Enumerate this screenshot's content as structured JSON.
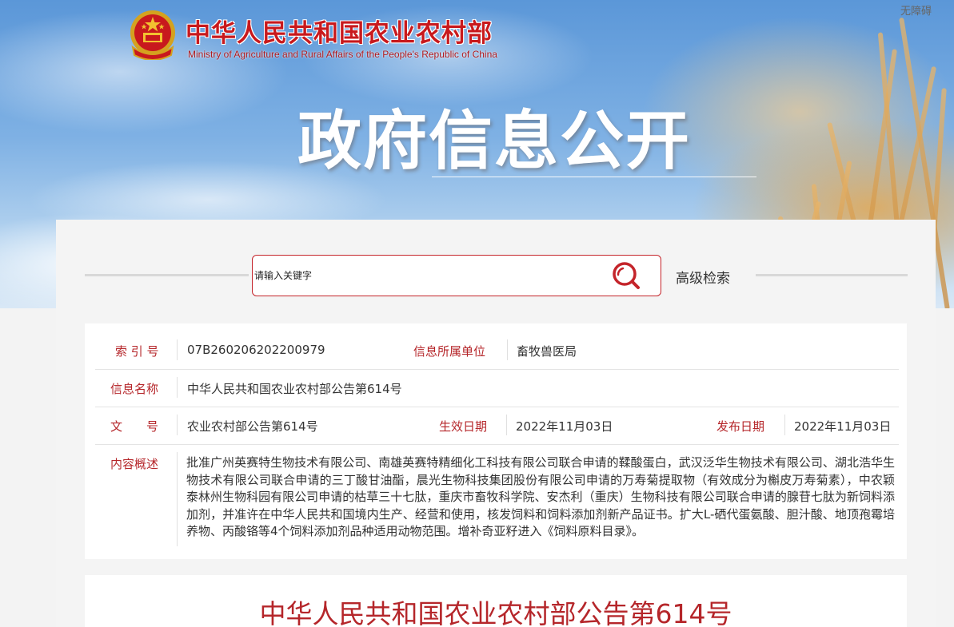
{
  "header": {
    "ministry_name_cn": "中华人民共和国农业农村部",
    "ministry_name_en": "Ministry of Agriculture and Rural Affairs of the People's Republic of China",
    "accessibility_link": "无障碍",
    "hero_title": "政府信息公开"
  },
  "search": {
    "placeholder": "请输入关键字",
    "advanced_label": "高级检索"
  },
  "info": {
    "index_label": "索 引 号",
    "index_value": "07B260206202200979",
    "unit_label": "信息所属单位",
    "unit_value": "畜牧兽医局",
    "name_label": "信息名称",
    "name_value": "中华人民共和国农业农村部公告第614号",
    "doc_no_label": "文　　号",
    "doc_no_value": "农业农村部公告第614号",
    "effective_label": "生效日期",
    "effective_value": "2022年11月03日",
    "publish_label": "发布日期",
    "publish_value": "2022年11月03日",
    "summary_label": "内容概述",
    "summary_value": "批准广州英赛特生物技术有限公司、南雄英赛特精细化工科技有限公司联合申请的鞣酸蛋白，武汉泛华生物技术有限公司、湖北浩华生物技术有限公司联合申请的三丁酸甘油酯，晨光生物科技集团股份有限公司申请的万寿菊提取物（有效成分为槲皮万寿菊素），中农颖泰林州生物科园有限公司申请的枯草三十七肽，重庆市畜牧科学院、安杰利（重庆）生物科技有限公司联合申请的腺苷七肽为新饲料添加剂，并准许在中华人民共和国境内生产、经营和使用，核发饲料和饲料添加剂新产品证书。扩大L-硒代蛋氨酸、胆汁酸、地顶孢霉培养物、丙酸铬等4个饲料添加剂品种适用动物范围。增补奇亚籽进入《饲料原料目录》。"
  },
  "article": {
    "title": "中华人民共和国农业农村部公告第614号"
  },
  "colors": {
    "accent_red": "#b5262a",
    "ministry_red": "#c8191d",
    "search_border": "#c4242a"
  },
  "icons": {
    "emblem": "national-emblem-icon",
    "search": "search-icon"
  }
}
